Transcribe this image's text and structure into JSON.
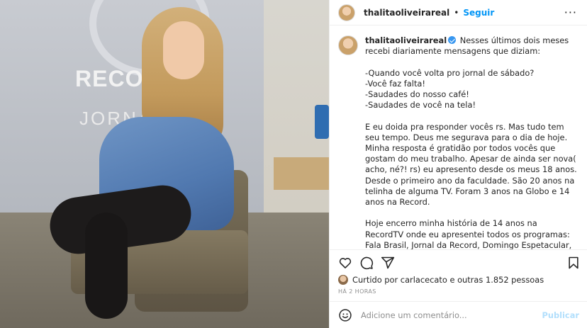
{
  "post": {
    "username": "thalitaoliveirareal",
    "follow_label": "Seguir",
    "separator": "•",
    "more_label": "···"
  },
  "photo": {
    "logo_text": "RECORDT",
    "sub_text": "JORNA"
  },
  "caption": {
    "username": "thalitaoliveirareal",
    "text": "Nesses últimos dois meses recebi diariamente mensagens que diziam:\n\n-Quando você volta pro jornal de sábado?\n-Você faz falta!\n-Saudades do nosso café!\n-Saudades de você na tela!\n\nE eu doida pra responder vocês rs. Mas tudo tem seu tempo. Deus me segurava para o dia de hoje.\nMinha resposta é gratidão por todos vocês que gostam do meu trabalho. Apesar de ainda ser nova( acho, né?! rs) eu apresento desde os meus 18 anos. Desde o primeiro ano da faculdade. São 20 anos na telinha de alguma TV. Foram 3 anos na Globo e 14 anos na Record.\n\nHoje encerro minha história de 14 anos na RecordTV onde eu apresentei todos os programas: Fala Brasil, Jornal da Record, Domingo Espetacular, Tudo a Ver, Esporte Fantástico, ancorei em Jogos Pan-americanos, Jornal da Record News, Esporte Record News, Balanço Geral, reportagens e viajei o Brasil inteiro sendo mestre de cerimônia representando o"
  },
  "actions": {
    "like_icon": "heart-icon",
    "comment_icon": "comment-icon",
    "share_icon": "send-icon",
    "save_icon": "bookmark-icon"
  },
  "likes": {
    "text": "Curtido por carlacecato e outras 1.852 pessoas"
  },
  "time": {
    "text": "HÁ 2 HORAS"
  },
  "comment_box": {
    "placeholder": "Adicione um comentário...",
    "publish_label": "Publicar",
    "emoji_icon": "emoji-icon"
  }
}
